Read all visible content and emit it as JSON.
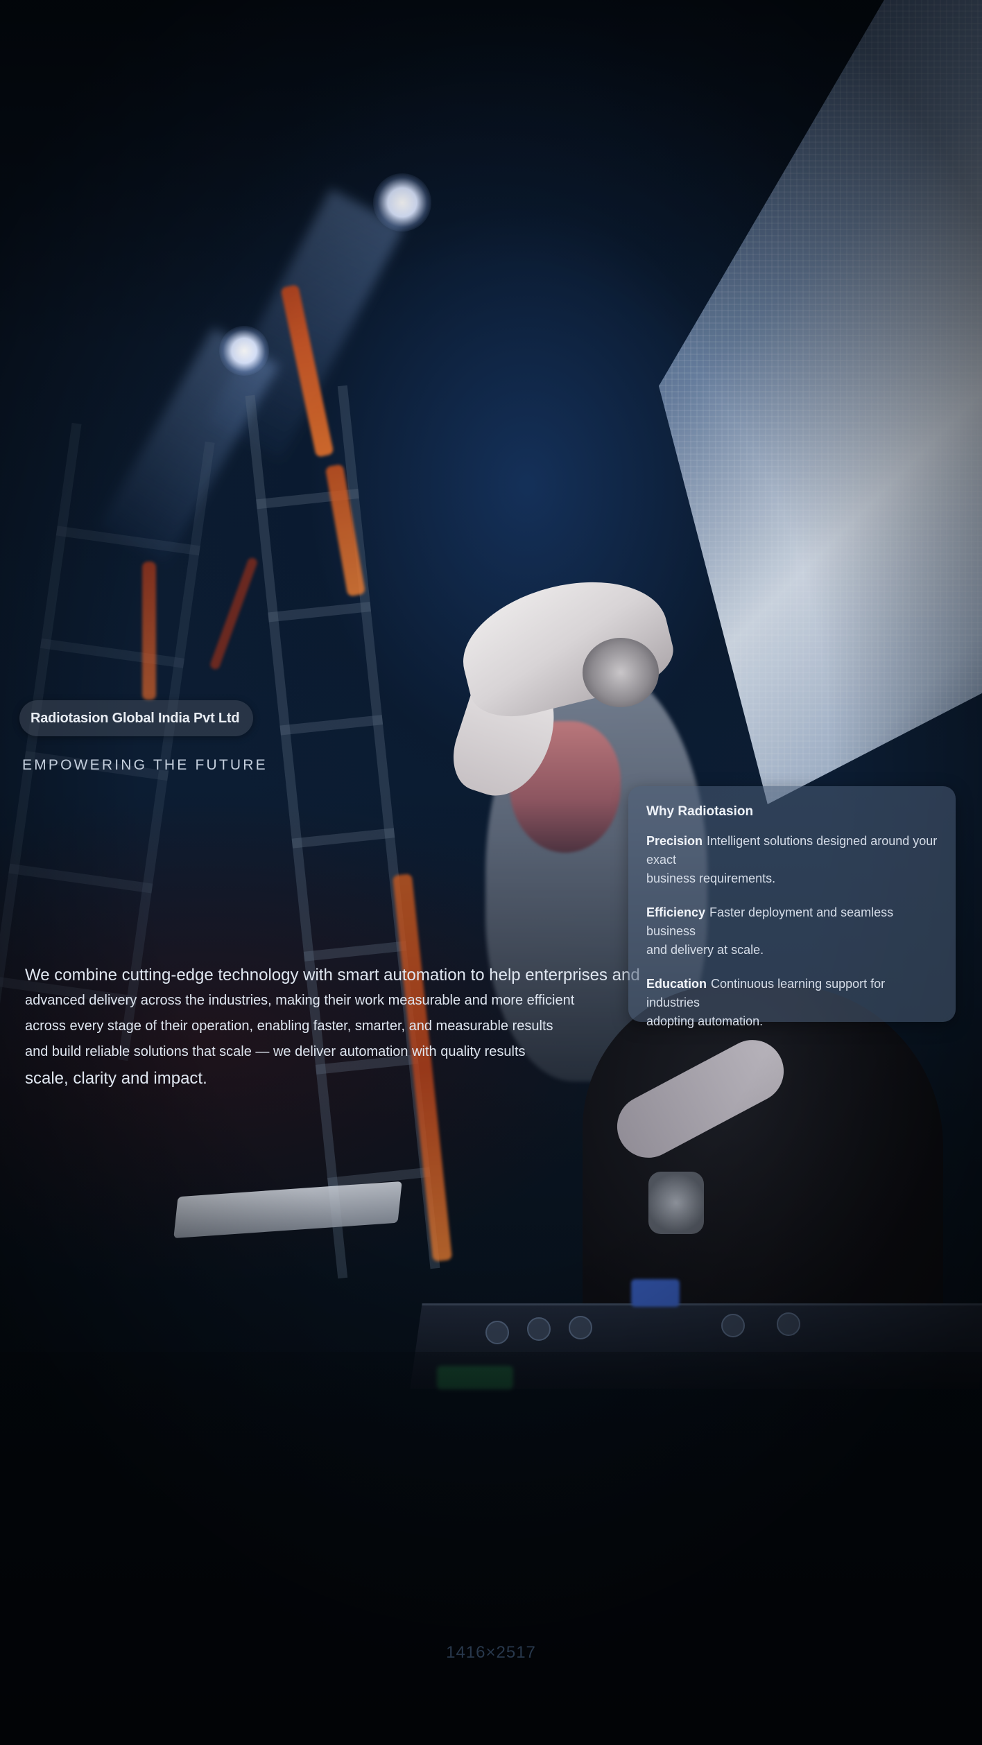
{
  "hero": {
    "company_name": "Radiotasion Global India Pvt Ltd",
    "tagline": "EMPOWERING THE FUTURE"
  },
  "about": {
    "lines": [
      "We combine cutting-edge technology with smart automation to help enterprises and",
      "advanced delivery across the industries, making their work measurable and more efficient",
      "across every stage of their operation, enabling faster, smarter, and measurable results",
      "and build reliable solutions that scale — we deliver automation with quality results",
      "scale, clarity and impact."
    ]
  },
  "why_card": {
    "title": "Why Radiotasion",
    "items": [
      {
        "term": "Precision",
        "text": "Intelligent solutions designed around your exact",
        "text2": "business requirements."
      },
      {
        "term": "Efficiency",
        "text": "Faster deployment and seamless business",
        "text2": "and delivery at scale."
      },
      {
        "term": "Education",
        "text": "Continuous learning support for industries",
        "text2": "adopting automation."
      }
    ]
  },
  "footer": {
    "dimensions": "1416×2517"
  },
  "colors": {
    "background": "#06101c",
    "card": "#4a5c76",
    "text_primary": "#e6ebf3",
    "accent_orange": "#e0702c"
  }
}
